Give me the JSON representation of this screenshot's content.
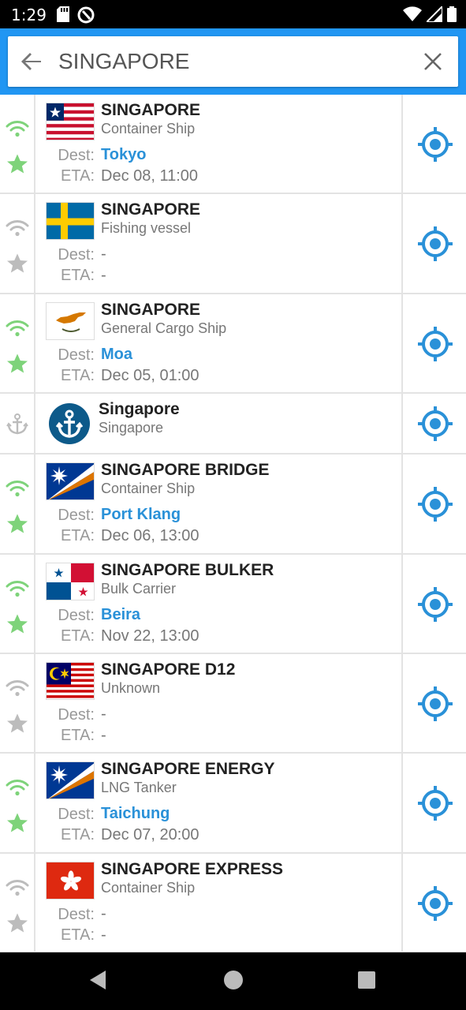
{
  "status_bar": {
    "time": "1:29"
  },
  "search": {
    "value": "SINGAPORE",
    "placeholder": ""
  },
  "colors": {
    "header": "#2196f3",
    "accent": "#2a91d8",
    "online": "#7ed37a",
    "offline": "#bcbcbc"
  },
  "results": [
    {
      "kind": "ship",
      "flag": "liberia",
      "online": true,
      "favorite": true,
      "name": "SINGAPORE",
      "type": "Container Ship",
      "dest_label": "Dest:",
      "dest": "Tokyo",
      "eta_label": "ETA:",
      "eta": "Dec 08, 11:00"
    },
    {
      "kind": "ship",
      "flag": "sweden",
      "online": false,
      "favorite": false,
      "name": "SINGAPORE",
      "type": "Fishing vessel",
      "dest_label": "Dest:",
      "dest": "-",
      "eta_label": "ETA:",
      "eta": "-"
    },
    {
      "kind": "ship",
      "flag": "cyprus",
      "online": true,
      "favorite": true,
      "name": "SINGAPORE",
      "type": "General Cargo Ship",
      "dest_label": "Dest:",
      "dest": "Moa",
      "eta_label": "ETA:",
      "eta": "Dec 05, 01:00"
    },
    {
      "kind": "port",
      "name": "Singapore",
      "subtitle": "Singapore"
    },
    {
      "kind": "ship",
      "flag": "marshall",
      "online": true,
      "favorite": true,
      "name": "SINGAPORE BRIDGE",
      "type": "Container Ship",
      "dest_label": "Dest:",
      "dest": "Port Klang",
      "eta_label": "ETA:",
      "eta": "Dec 06, 13:00"
    },
    {
      "kind": "ship",
      "flag": "panama",
      "online": true,
      "favorite": true,
      "name": "SINGAPORE BULKER",
      "type": "Bulk Carrier",
      "dest_label": "Dest:",
      "dest": "Beira",
      "eta_label": "ETA:",
      "eta": "Nov 22, 13:00"
    },
    {
      "kind": "ship",
      "flag": "malaysia",
      "online": false,
      "favorite": false,
      "name": "SINGAPORE D12",
      "type": "Unknown",
      "dest_label": "Dest:",
      "dest": "-",
      "eta_label": "ETA:",
      "eta": "-"
    },
    {
      "kind": "ship",
      "flag": "marshall",
      "online": true,
      "favorite": true,
      "name": "SINGAPORE ENERGY",
      "type": "LNG Tanker",
      "dest_label": "Dest:",
      "dest": "Taichung",
      "eta_label": "ETA:",
      "eta": "Dec 07, 20:00"
    },
    {
      "kind": "ship",
      "flag": "hongkong",
      "online": false,
      "favorite": false,
      "name": "SINGAPORE EXPRESS",
      "type": "Container Ship",
      "dest_label": "Dest:",
      "dest": "-",
      "eta_label": "ETA:",
      "eta": "-"
    }
  ]
}
